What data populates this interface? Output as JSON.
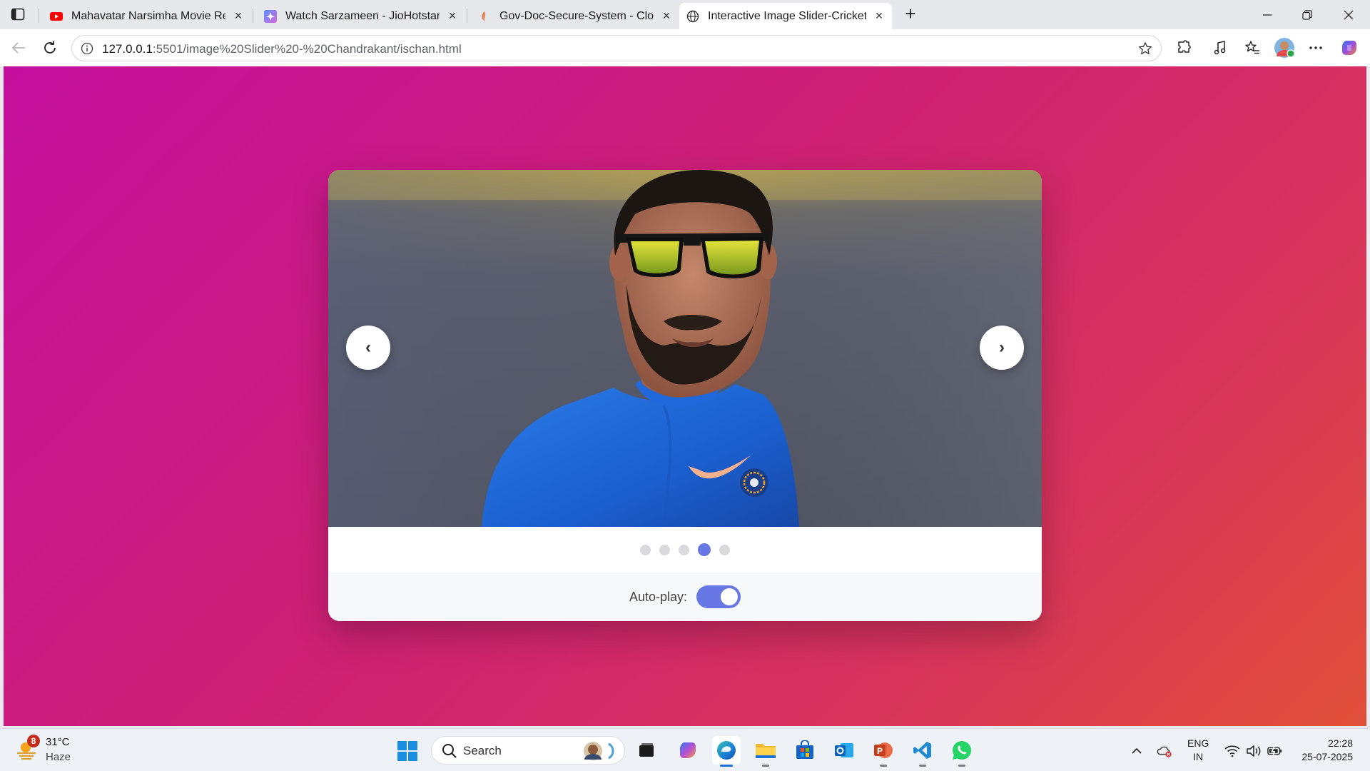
{
  "browser": {
    "tabs": [
      {
        "title": "Mahavatar Narsimha Movie Revie",
        "favicon": "youtube-icon",
        "active": false
      },
      {
        "title": "Watch Sarzameen - JioHotstar",
        "favicon": "jiohotstar-icon",
        "active": false
      },
      {
        "title": "Gov-Doc-Secure-System - Cloud",
        "favicon": "cloud-icon",
        "active": false
      },
      {
        "title": "Interactive Image Slider-Cricketer",
        "favicon": "globe-icon",
        "active": true
      }
    ],
    "url_host": "127.0.0.1",
    "url_rest": ":5501/image%20Slider%20-%20Chandrakant/ischan.html"
  },
  "slider": {
    "prev_label": "‹",
    "next_label": "›",
    "slide_count": 5,
    "active_slide": 4,
    "autoplay_label": "Auto-play:",
    "autoplay_on": true,
    "accent_color": "#6777e3"
  },
  "taskbar": {
    "weather_badge": "8",
    "temperature": "31°C",
    "condition": "Haze",
    "search_placeholder": "Search",
    "lang_top": "ENG",
    "lang_bottom": "IN",
    "time": "22:28",
    "date": "25-07-2025"
  }
}
